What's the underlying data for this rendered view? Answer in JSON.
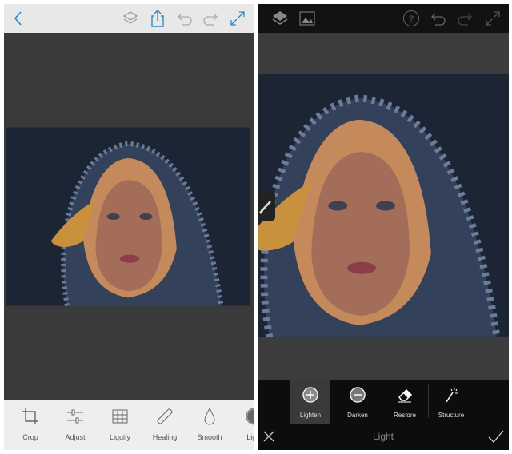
{
  "left": {
    "icons": [
      "back-icon",
      "layers-icon",
      "share-icon",
      "undo-icon",
      "redo-icon",
      "expand-icon"
    ],
    "accent": "#2b8bc6",
    "tools": [
      {
        "label": "Crop",
        "icon": "crop-icon"
      },
      {
        "label": "Adjust",
        "icon": "adjust-icon"
      },
      {
        "label": "Liquify",
        "icon": "liquify-icon"
      },
      {
        "label": "Healing",
        "icon": "healing-icon"
      },
      {
        "label": "Smooth",
        "icon": "smooth-icon"
      },
      {
        "label": "Light",
        "icon": "light-icon"
      }
    ]
  },
  "right": {
    "icons": [
      "layers-icon",
      "image-icon",
      "help-icon",
      "undo-icon",
      "redo-icon",
      "expand-icon"
    ],
    "tools": [
      {
        "label": "Lighten",
        "icon": "lighten-icon",
        "selected": true
      },
      {
        "label": "Darken",
        "icon": "darken-icon"
      },
      {
        "label": "Restore",
        "icon": "eraser-icon"
      },
      {
        "label": "Structure",
        "icon": "magic-wand-icon"
      }
    ],
    "mode_title": "Light"
  }
}
